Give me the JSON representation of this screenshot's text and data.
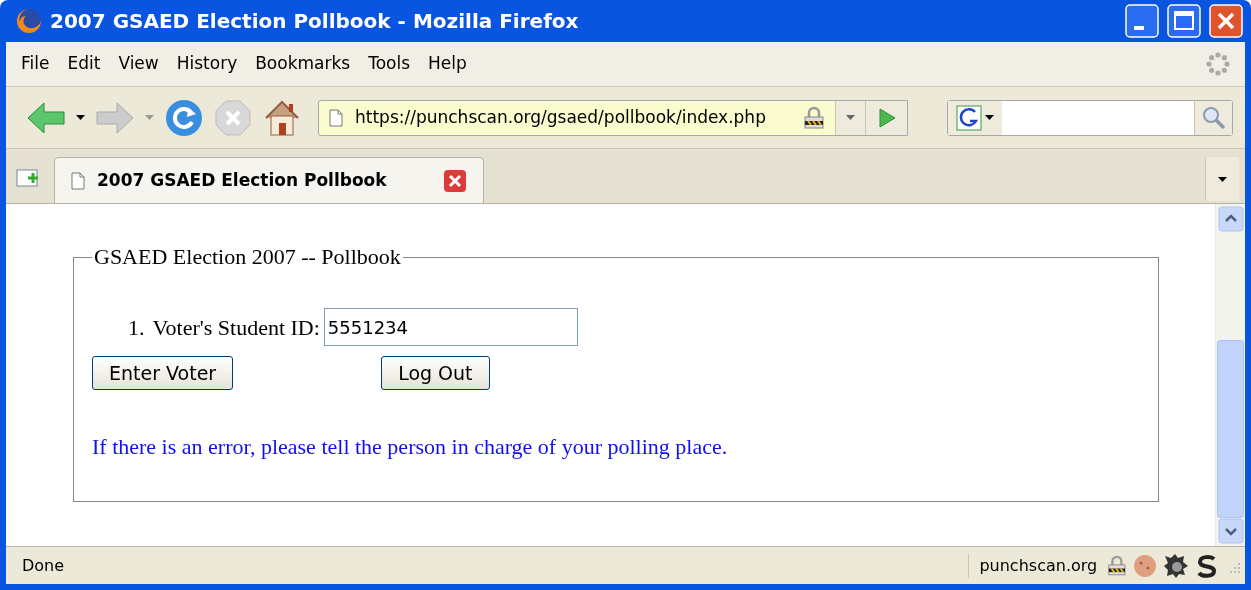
{
  "window": {
    "title": "2007 GSAED Election Pollbook - Mozilla Firefox"
  },
  "menu": [
    "File",
    "Edit",
    "View",
    "History",
    "Bookmarks",
    "Tools",
    "Help"
  ],
  "address_bar": {
    "value": "https://punchscan.org/gsaed/pollbook/index.php",
    "secure": true
  },
  "tabs": [
    {
      "label": "2007 GSAED Election Pollbook",
      "selected": true
    }
  ],
  "page": {
    "legend": "GSAED Election 2007 -- Pollbook",
    "fields": [
      {
        "number": "1.",
        "label": "Voter's Student ID:",
        "value": "5551234"
      }
    ],
    "buttons": [
      "Enter Voter",
      "Log Out"
    ],
    "notice": "If there is an error, please tell the person in charge of your polling place."
  },
  "status_bar": {
    "status": "Done",
    "domain": "punchscan.org"
  }
}
